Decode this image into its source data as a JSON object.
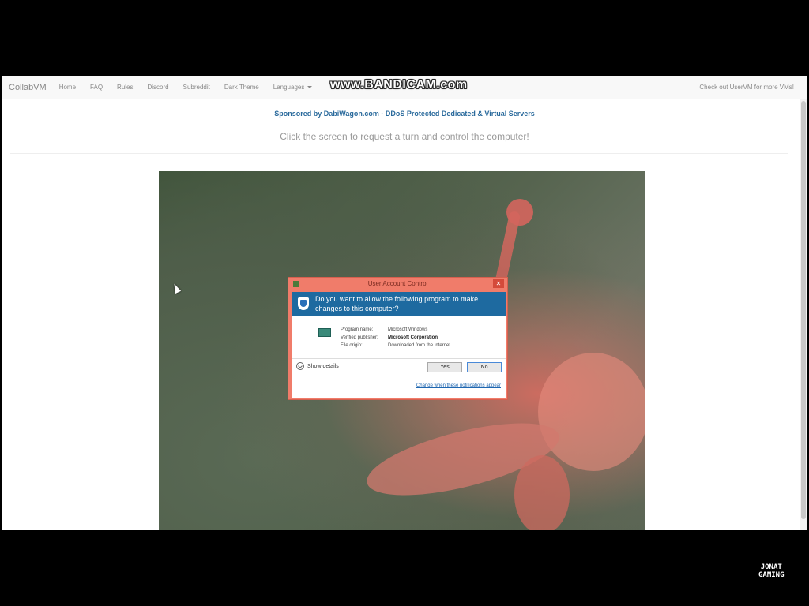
{
  "navbar": {
    "brand": "CollabVM",
    "items": [
      "Home",
      "FAQ",
      "Rules",
      "Discord",
      "Subreddit",
      "Dark Theme"
    ],
    "languages_label": "Languages",
    "right_link": "Check out UserVM for more VMs!"
  },
  "watermark": "www.BANDICAM.com",
  "sponsor_text": "Sponsored by DabiWagon.com - DDoS Protected Dedicated & Virtual Servers",
  "instruction_text": "Click the screen to request a turn and control the computer!",
  "uac": {
    "title": "User Account Control",
    "close_label": "✕",
    "question": "Do you want to allow the following program to make changes to this computer?",
    "program_name_label": "Program name:",
    "program_name_value": "Microsoft Windows",
    "publisher_label": "Verified publisher:",
    "publisher_value": "Microsoft Corporation",
    "origin_label": "File origin:",
    "origin_value": "Downloaded from the Internet",
    "show_details": "Show details",
    "yes_label": "Yes",
    "no_label": "No",
    "change_link": "Change when these notifications appear"
  },
  "corner_logo": {
    "line1": "JONAT",
    "line2": "GAMING"
  },
  "colors": {
    "uac_frame": "#f07c6a",
    "uac_header": "#1e6aa0",
    "sponsor_text": "#2a6a9c"
  }
}
